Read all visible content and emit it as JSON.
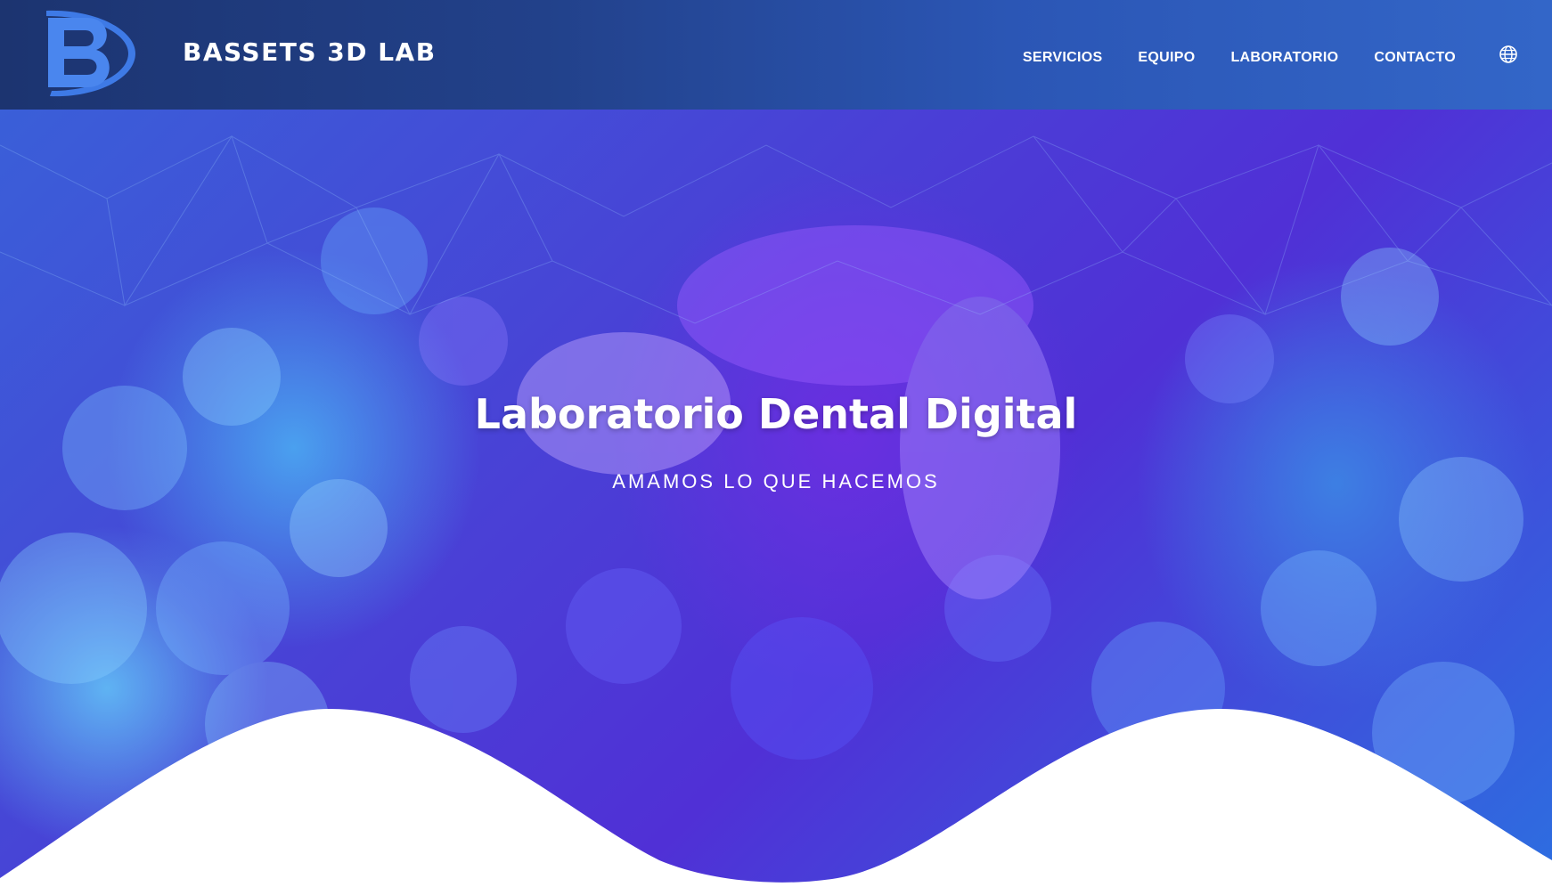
{
  "header": {
    "brand_name": "BASSETS 3D LAB",
    "logo_letter": "B",
    "nav": [
      {
        "label": "SERVICIOS"
      },
      {
        "label": "EQUIPO"
      },
      {
        "label": "LABORATORIO"
      },
      {
        "label": "CONTACTO"
      }
    ],
    "language_icon": "globe-icon"
  },
  "hero": {
    "title": "Laboratorio Dental Digital",
    "subtitle": "AMAMOS LO QUE HACEMOS"
  },
  "colors": {
    "header_dark": "#1c3470",
    "header_light": "#3366c8",
    "logo_blue": "#3e7ae6",
    "hero_purple": "#5030d6",
    "hero_blue": "#3a5fd8",
    "wave_white": "#ffffff"
  }
}
